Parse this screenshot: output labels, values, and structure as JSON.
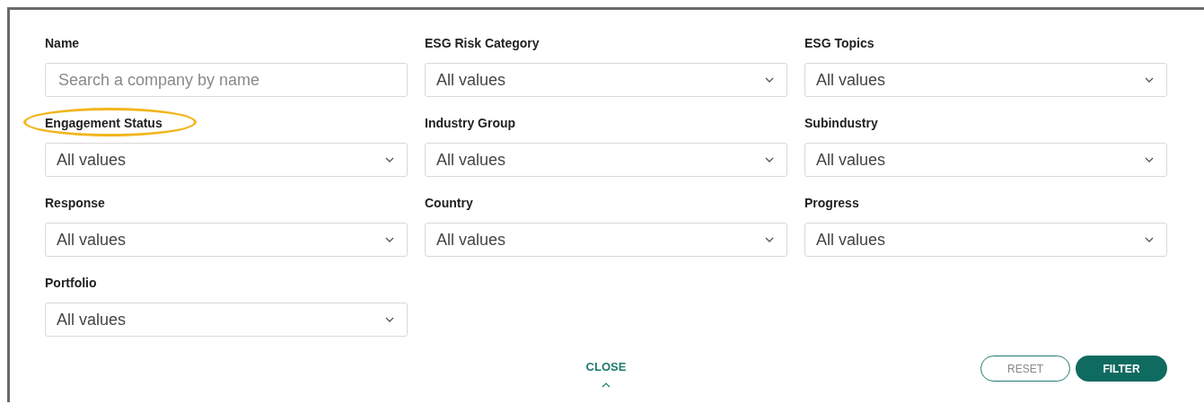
{
  "filters": [
    {
      "label": "Name",
      "kind": "search",
      "placeholder": "Search a company by name",
      "highlighted": false
    },
    {
      "label": "ESG Risk Category",
      "kind": "select",
      "value": "All values",
      "highlighted": false
    },
    {
      "label": "ESG Topics",
      "kind": "select",
      "value": "All values",
      "highlighted": false
    },
    {
      "label": "Engagement Status",
      "kind": "select",
      "value": "All values",
      "highlighted": true
    },
    {
      "label": "Industry Group",
      "kind": "select",
      "value": "All values",
      "highlighted": false
    },
    {
      "label": "Subindustry",
      "kind": "select",
      "value": "All values",
      "highlighted": false
    },
    {
      "label": "Response",
      "kind": "select",
      "value": "All values",
      "highlighted": false
    },
    {
      "label": "Country",
      "kind": "select",
      "value": "All values",
      "highlighted": false
    },
    {
      "label": "Progress",
      "kind": "select",
      "value": "All values",
      "highlighted": false
    },
    {
      "label": "Portfolio",
      "kind": "select",
      "value": "All values",
      "highlighted": false
    }
  ],
  "close": {
    "label": "CLOSE"
  },
  "buttons": [
    {
      "label": "RESET",
      "kind": "outline"
    },
    {
      "label": "FILTER",
      "kind": "primary"
    }
  ]
}
